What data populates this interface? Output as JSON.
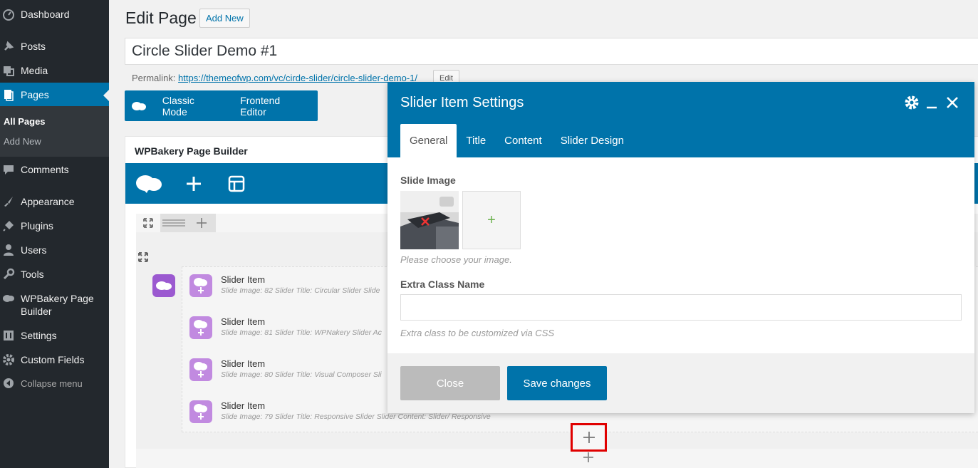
{
  "sidebar": {
    "items": [
      {
        "label": "Dashboard",
        "icon": "dashboard-icon"
      },
      {
        "label": "Posts",
        "icon": "pin-icon"
      },
      {
        "label": "Media",
        "icon": "media-icon"
      },
      {
        "label": "Pages",
        "icon": "pages-icon"
      },
      {
        "label": "Comments",
        "icon": "comment-icon"
      },
      {
        "label": "Appearance",
        "icon": "brush-icon"
      },
      {
        "label": "Plugins",
        "icon": "plugin-icon"
      },
      {
        "label": "Users",
        "icon": "user-icon"
      },
      {
        "label": "Tools",
        "icon": "wrench-icon"
      },
      {
        "label": "WPBakery Page Builder",
        "icon": "wpbakery-icon"
      },
      {
        "label": "Settings",
        "icon": "settings-icon"
      },
      {
        "label": "Custom Fields",
        "icon": "gear-icon"
      },
      {
        "label": "Collapse menu",
        "icon": "collapse-icon"
      }
    ],
    "submenu": [
      "All Pages",
      "Add New"
    ]
  },
  "header": {
    "title": "Edit Page",
    "add_new": "Add New",
    "post_title": "Circle Slider Demo #1",
    "permalink_label": "Permalink:",
    "permalink_url": "https://themeofwp.com/vc/cirde-slider/circle-slider-demo-1/",
    "permalink_edit": "Edit"
  },
  "vc_switch": {
    "classic": "Classic Mode",
    "frontend": "Frontend Editor"
  },
  "builder": {
    "title": "WPBakery Page Builder",
    "items": [
      {
        "title": "Slider Item",
        "desc": "Slide Image: 82  Slider Title: Circular Slider  Slide"
      },
      {
        "title": "Slider Item",
        "desc": "Slide Image: 81  Slider Title: WPNakery Slider Ac"
      },
      {
        "title": "Slider Item",
        "desc": "Slide Image: 80  Slider Title: Visual Composer Sli"
      },
      {
        "title": "Slider Item",
        "desc": "Slide Image: 79  Slider Title: Responsive Slider  Slider Content: Slider/ Responsive"
      }
    ],
    "add_symbol": "+"
  },
  "modal": {
    "title": "Slider Item Settings",
    "tabs": [
      "General",
      "Title",
      "Content",
      "Slider Design"
    ],
    "slide_image_label": "Slide Image",
    "slide_image_help": "Please choose your image.",
    "add_image_symbol": "+",
    "extra_class_label": "Extra Class Name",
    "extra_class_value": "",
    "extra_class_help": "Extra class to be customized via CSS",
    "close_label": "Close",
    "save_label": "Save changes"
  },
  "colors": {
    "accent": "#0073aa",
    "sidebar_bg": "#23282d",
    "highlight": "#e00000",
    "element_icon": "#c18ae0"
  }
}
